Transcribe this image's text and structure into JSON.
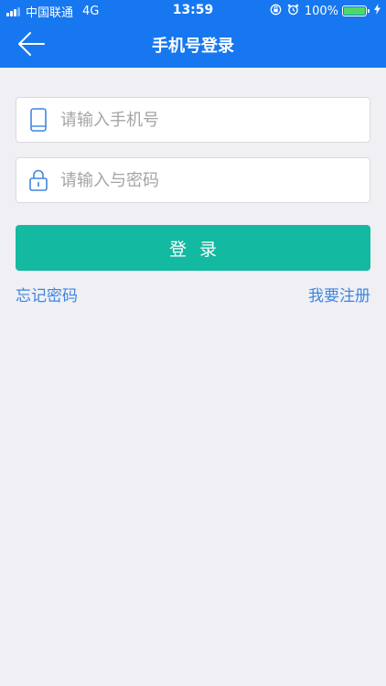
{
  "status_bar": {
    "carrier": "中国联通",
    "network": "4G",
    "time": "13:59",
    "battery_percent": "100%",
    "battery_color": "#4cd964"
  },
  "nav": {
    "title": "手机号登录",
    "back_icon": "arrow-left-icon"
  },
  "form": {
    "phone_placeholder": "请输入手机号",
    "phone_icon": "phone-icon",
    "password_placeholder": "请输入与密码",
    "password_icon": "lock-icon",
    "login_label": "登录"
  },
  "links": {
    "forgot": "忘记密码",
    "register": "我要注册"
  },
  "colors": {
    "primary": "#1677f0",
    "button": "#13b9a0",
    "link": "#3e86e0",
    "background": "#efeff4"
  }
}
